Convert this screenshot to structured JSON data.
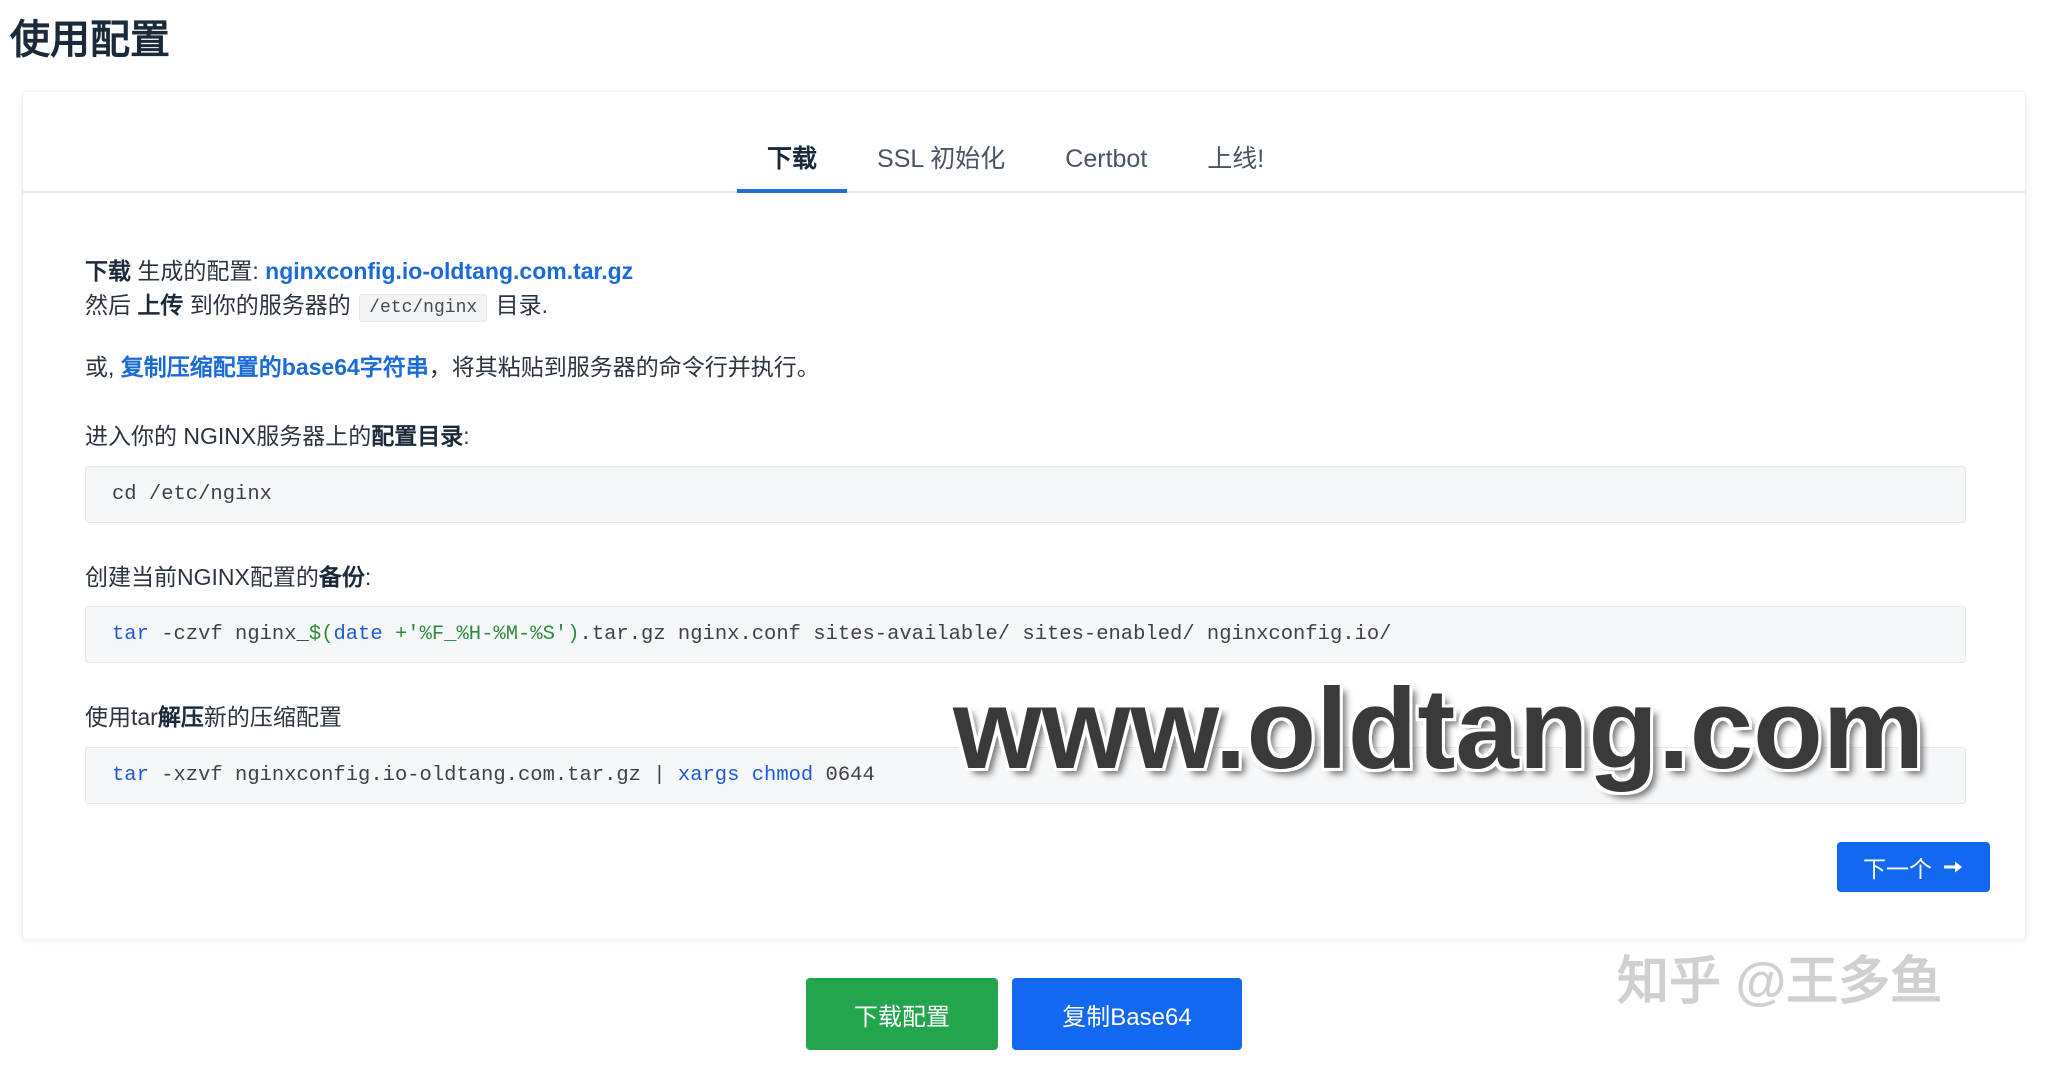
{
  "page": {
    "title": "使用配置"
  },
  "tabs": [
    {
      "label": "下载",
      "active": true
    },
    {
      "label": "SSL 初始化",
      "active": false
    },
    {
      "label": "Certbot",
      "active": false
    },
    {
      "label": "上线!",
      "active": false
    }
  ],
  "download_step": {
    "line1": {
      "bold": "下载",
      "text": " 生成的配置: ",
      "link": "nginxconfig.io-oldtang.com.tar.gz"
    },
    "line2": {
      "prefix": "然后 ",
      "bold": "上传",
      "middle": " 到你的服务器的 ",
      "code": "/etc/nginx",
      "suffix": " 目录."
    },
    "line3": {
      "prefix": "或, ",
      "link": "复制压缩配置的base64字符串",
      "suffix": "，将其粘贴到服务器的命令行并执行。"
    }
  },
  "steps": [
    {
      "label_prefix": "进入你的 NGINX服务器上的",
      "label_bold": "配置目录",
      "label_suffix": ":",
      "code": [
        "cd /etc/nginx"
      ]
    },
    {
      "label_prefix": "创建当前NGINX配置的",
      "label_bold": "备份",
      "label_suffix": ":",
      "code": [
        "tar",
        " -czvf nginx_",
        "$(",
        "date",
        " +'%F_%H-%M-%S')",
        ".tar.gz nginx.conf sites-available/ sites-enabled/ nginxconfig.io/"
      ]
    },
    {
      "label_prefix": "使用tar",
      "label_bold": "解压",
      "label_suffix": "新的压缩配置",
      "code": [
        "tar",
        " -xzvf nginxconfig.io-oldtang.com.tar.gz | ",
        "xargs",
        " chmod",
        " 0644"
      ]
    }
  ],
  "next_button": {
    "label": "下一个",
    "icon": "arrow-right-icon"
  },
  "actions": {
    "download_label": "下载配置",
    "copy_label": "复制Base64"
  },
  "watermarks": {
    "site": "www.oldtang.com",
    "zhihu": "知乎 @王多鱼"
  },
  "colors": {
    "title": "#1b2a3a",
    "text": "#2b3440",
    "link": "#1b6bd6",
    "tab-active": "#1f6fd6",
    "code-keyword": "#1d5bd2",
    "code-string": "#2e8b3d",
    "code-plain": "#3d424a",
    "btn-green": "#22a54d",
    "btn-blue": "#1268ef"
  }
}
